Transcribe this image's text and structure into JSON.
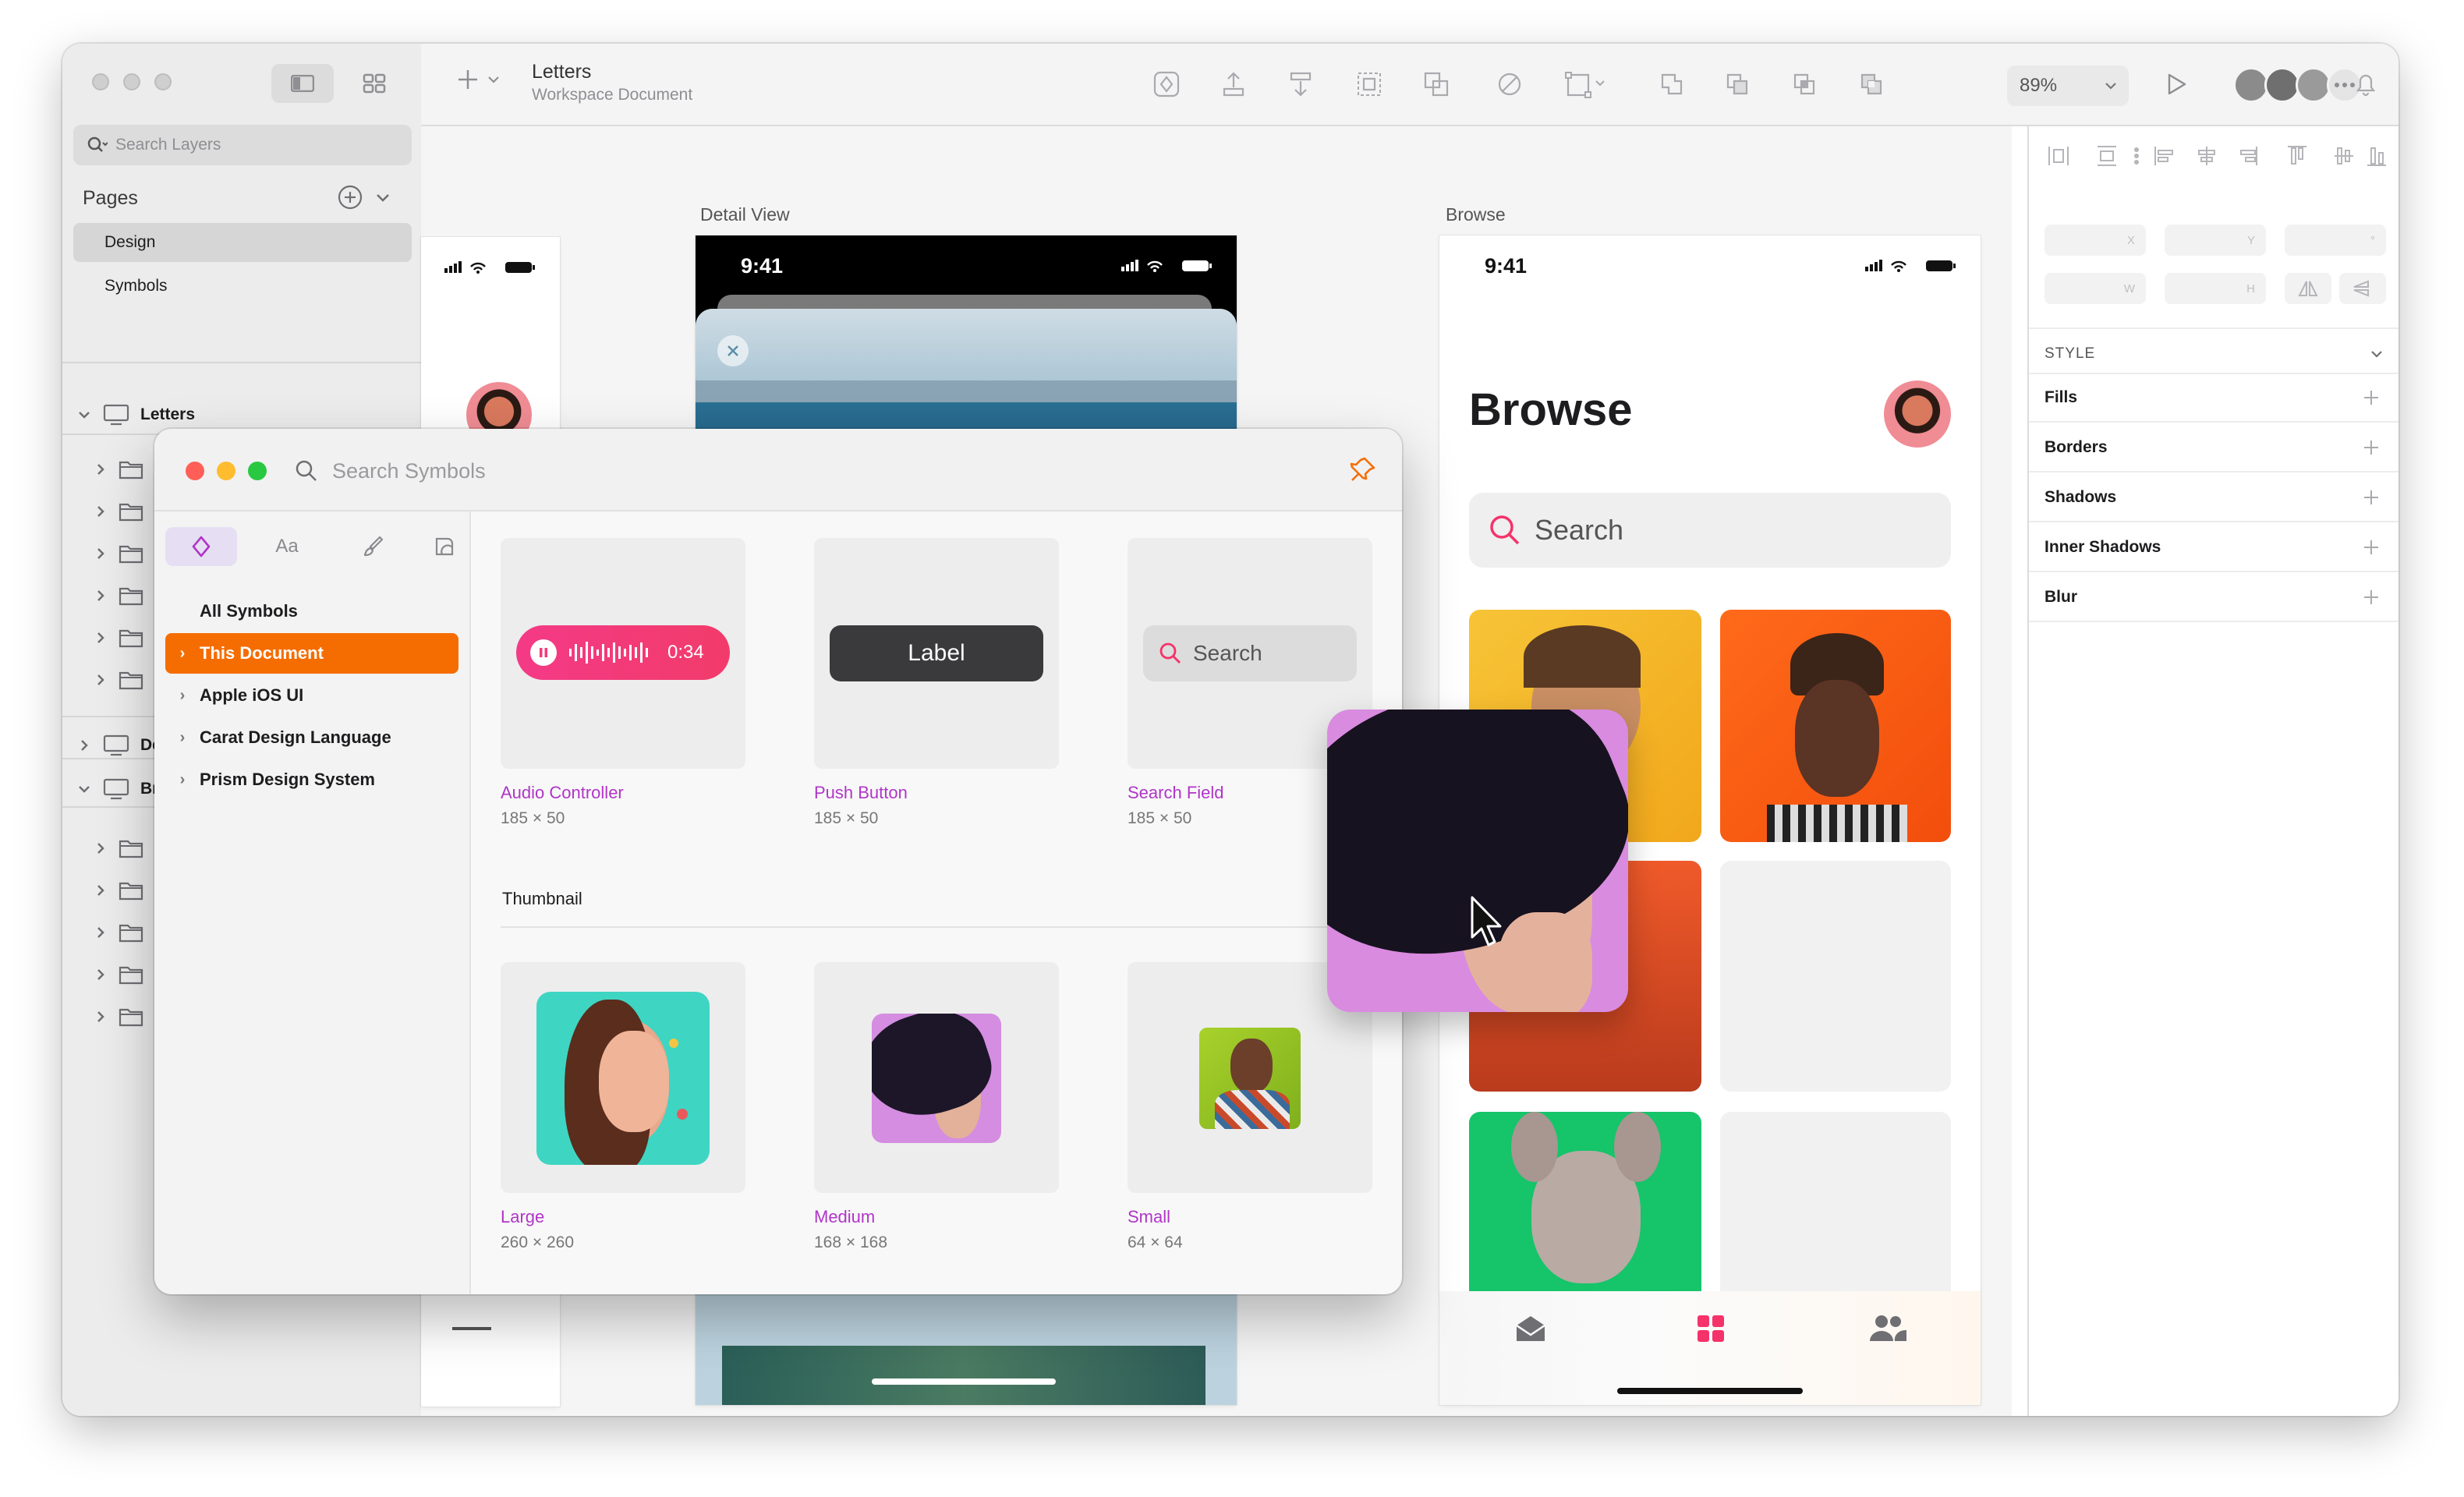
{
  "toolbar": {
    "doc_title": "Letters",
    "doc_subtitle": "Workspace Document",
    "zoom": "89%"
  },
  "sidebar": {
    "search_placeholder": "Search Layers",
    "pages_heading": "Pages",
    "pages": [
      {
        "label": "Design",
        "selected": true
      },
      {
        "label": "Symbols",
        "selected": false
      }
    ],
    "layer_groups": [
      {
        "label": "Letters"
      },
      {
        "label": "De"
      },
      {
        "label": "Br"
      }
    ]
  },
  "canvas": {
    "detail_label": "Detail View",
    "browse_label": "Browse",
    "status_time": "9:41",
    "browse_title": "Browse",
    "browse_search": "Search"
  },
  "inspector": {
    "fields": [
      "X",
      "Y",
      "°",
      "W",
      "H"
    ],
    "style_heading": "STYLE",
    "rows": [
      "Fills",
      "Borders",
      "Shadows",
      "Inner Shadows",
      "Blur"
    ]
  },
  "symbols": {
    "search_placeholder": "Search Symbols",
    "tabs": [
      "symbol-tab",
      "Aa",
      "brush-tab",
      "layer-style-tab"
    ],
    "tree": [
      {
        "label": "All Symbols",
        "selected": false,
        "chevron": false
      },
      {
        "label": "This Document",
        "selected": true,
        "chevron": true
      },
      {
        "label": "Apple iOS UI",
        "selected": false,
        "chevron": true
      },
      {
        "label": "Carat Design Language",
        "selected": false,
        "chevron": true
      },
      {
        "label": "Prism Design System",
        "selected": false,
        "chevron": true
      }
    ],
    "audio_time": "0:34",
    "push_label": "Label",
    "search_field_text": "Search",
    "tiles_top": [
      {
        "name": "Audio Controller",
        "size": "185 × 50"
      },
      {
        "name": "Push Button",
        "size": "185 × 50"
      },
      {
        "name": "Search Field",
        "size": "185 × 50"
      }
    ],
    "section_heading": "Thumbnail",
    "tiles_bottom": [
      {
        "name": "Large",
        "size": "260 × 260"
      },
      {
        "name": "Medium",
        "size": "168 × 168"
      },
      {
        "name": "Small",
        "size": "64 × 64"
      }
    ]
  },
  "colors": {
    "accent_orange": "#f56d00",
    "symbol_purple": "#b035c8",
    "audio_pink": "#f23b78",
    "tab_active_pink": "#f5326a"
  }
}
